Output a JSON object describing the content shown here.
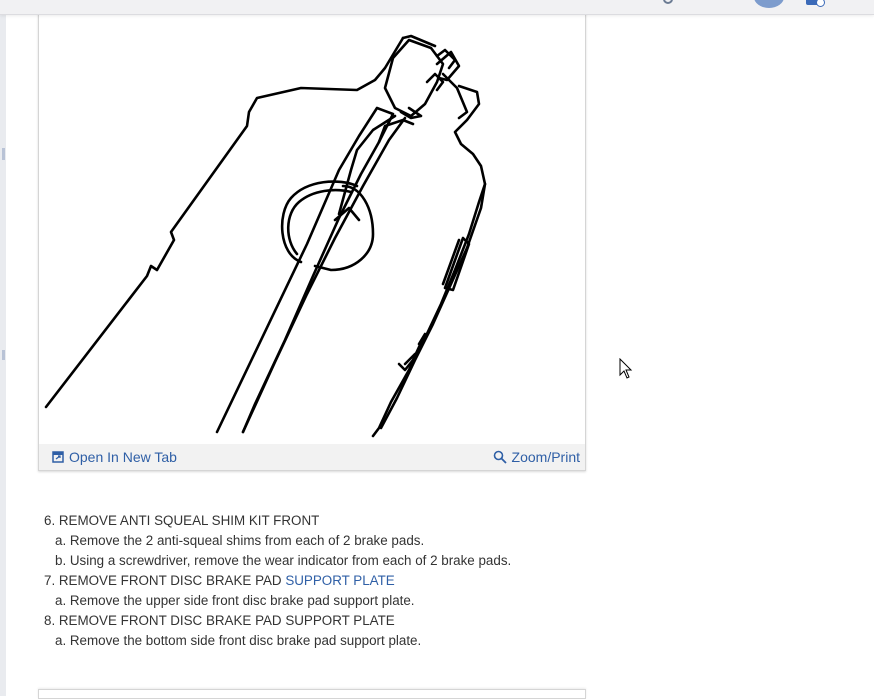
{
  "figure": {
    "open_tab_label": "Open In New Tab",
    "zoom_label": "Zoom/Print",
    "icons": [
      "open-new-tab-icon",
      "zoom-icon"
    ]
  },
  "steps": {
    "s6": {
      "title": "6. REMOVE ANTI SQUEAL SHIM KIT FRONT",
      "a": "a. Remove the 2 anti-squeal shims from each of 2 brake pads.",
      "b": "b. Using a screwdriver, remove the wear indicator from each of 2 brake pads."
    },
    "s7": {
      "title_prefix": "7. REMOVE FRONT DISC BRAKE PAD ",
      "title_link": "SUPPORT PLATE",
      "a": "a. Remove the upper side front disc brake pad support plate."
    },
    "s8": {
      "title": "8. REMOVE FRONT DISC BRAKE PAD SUPPORT PLATE",
      "a": "a. Remove the bottom side front disc brake pad support plate."
    }
  },
  "colors": {
    "link": "#2f5fa6",
    "text": "#333333",
    "toolbar_bg": "#f2f2f2"
  }
}
